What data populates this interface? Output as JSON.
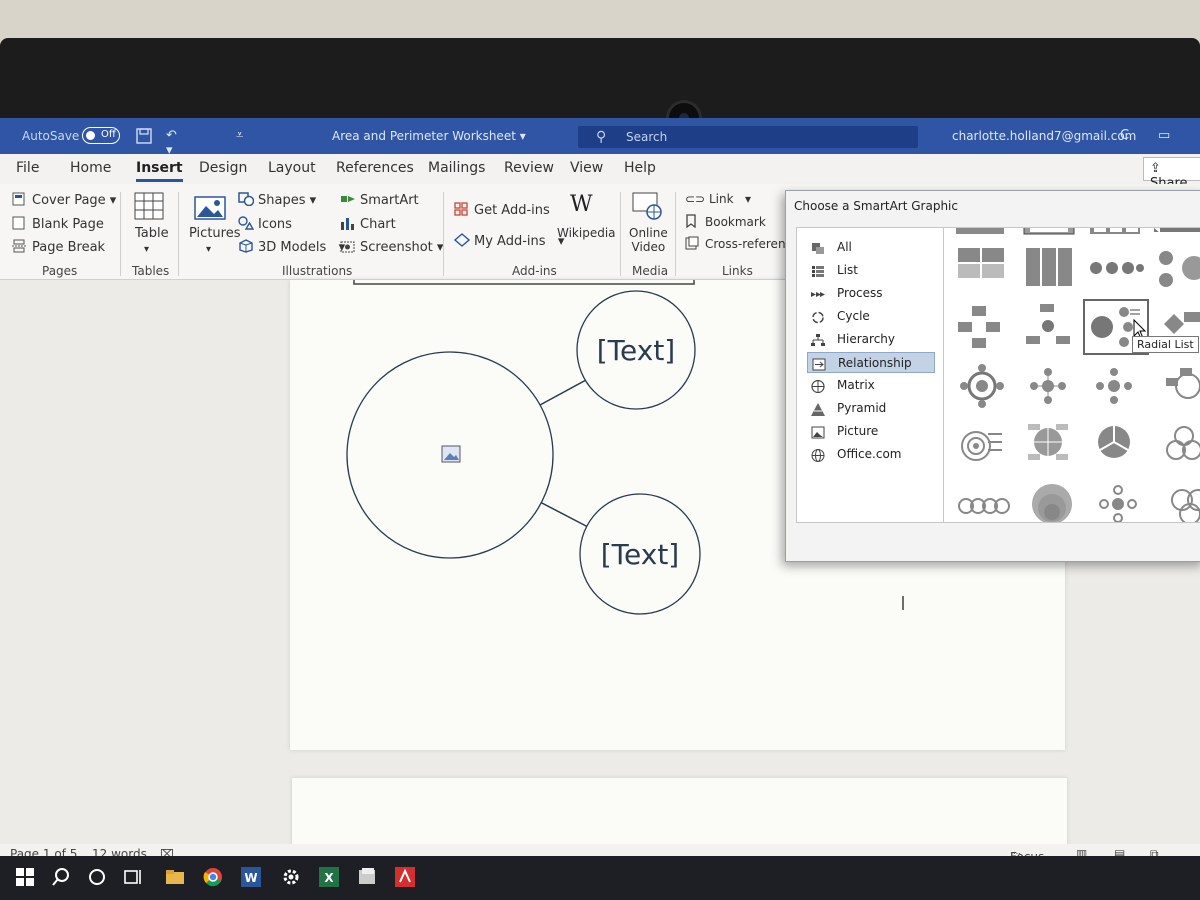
{
  "titlebar": {
    "autosave_label": "AutoSave",
    "autosave_state": "Off",
    "document_title": "Area and Perimeter Worksheet",
    "search_placeholder": "Search",
    "account": "charlotte.holland7@gmail.com",
    "account_initial": "C"
  },
  "tabs": [
    "File",
    "Home",
    "Insert",
    "Design",
    "Layout",
    "References",
    "Mailings",
    "Review",
    "View",
    "Help"
  ],
  "active_tab": "Insert",
  "share_label": "Share",
  "ribbon": {
    "pages": {
      "cover_page": "Cover Page",
      "blank_page": "Blank Page",
      "page_break": "Page Break",
      "group": "Pages"
    },
    "tables": {
      "table": "Table",
      "group": "Tables"
    },
    "illustrations": {
      "pictures": "Pictures",
      "shapes": "Shapes",
      "icons": "Icons",
      "models": "3D Models",
      "smartart": "SmartArt",
      "chart": "Chart",
      "screenshot": "Screenshot",
      "group": "Illustrations"
    },
    "addins": {
      "get": "Get Add-ins",
      "my": "My Add-ins",
      "wikipedia": "Wikipedia",
      "group": "Add-ins"
    },
    "media": {
      "online_video_1": "Online",
      "online_video_2": "Video",
      "group": "Media"
    },
    "links": {
      "link": "Link",
      "bookmark": "Bookmark",
      "cross_reference": "Cross-reference",
      "group": "Links"
    }
  },
  "smartart": {
    "top_text": "[Text]",
    "bottom_text": "[Text]"
  },
  "dialog": {
    "title": "Choose a SmartArt Graphic",
    "categories": [
      "All",
      "List",
      "Process",
      "Cycle",
      "Hierarchy",
      "Relationship",
      "Matrix",
      "Pyramid",
      "Picture",
      "Office.com"
    ],
    "selected_category": "Relationship",
    "tooltip": "Radial List"
  },
  "status": {
    "page": "Page 1 of 5",
    "words": "12 words",
    "focus": "Focus"
  },
  "colors": {
    "title_blue": "#2f55a4",
    "accent": "#2b579a",
    "selection": "#c4d2e6"
  }
}
